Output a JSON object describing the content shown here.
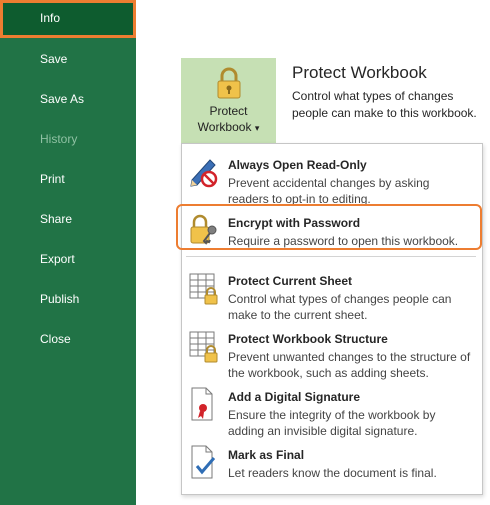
{
  "sidebar": {
    "items": [
      {
        "label": "Info",
        "state": "active"
      },
      {
        "label": "Save",
        "state": "normal"
      },
      {
        "label": "Save As",
        "state": "normal"
      },
      {
        "label": "History",
        "state": "disabled"
      },
      {
        "label": "Print",
        "state": "normal"
      },
      {
        "label": "Share",
        "state": "normal"
      },
      {
        "label": "Export",
        "state": "normal"
      },
      {
        "label": "Publish",
        "state": "normal"
      },
      {
        "label": "Close",
        "state": "normal"
      }
    ]
  },
  "protect": {
    "button_line1": "Protect",
    "button_line2": "Workbook",
    "button_caret": "▾",
    "title": "Protect Workbook",
    "description": "Control what types of changes people can make to this workbook."
  },
  "menu": {
    "items": [
      {
        "title": "Always Open Read-Only",
        "desc": "Prevent accidental changes by asking readers to opt-in to editing.",
        "icon": "pencil-no-icon"
      },
      {
        "title": "Encrypt with Password",
        "desc": "Require a password to open this workbook.",
        "icon": "lock-key-icon"
      },
      {
        "title": "Protect Current Sheet",
        "desc": "Control what types of changes people can make to the current sheet.",
        "icon": "sheet-lock-icon"
      },
      {
        "title": "Protect Workbook Structure",
        "desc": "Prevent unwanted changes to the structure of the workbook, such as adding sheets.",
        "icon": "workbook-lock-icon"
      },
      {
        "title": "Add a Digital Signature",
        "desc": "Ensure the integrity of the workbook by adding an invisible digital signature.",
        "icon": "signature-ribbon-icon"
      },
      {
        "title": "Mark as Final",
        "desc": "Let readers know the document is final.",
        "icon": "document-check-icon"
      }
    ]
  },
  "colors": {
    "sidebar": "#217346",
    "active_item": "#0e5c2f",
    "highlight": "#ed7d31",
    "button_bg": "#c6e0b4"
  }
}
